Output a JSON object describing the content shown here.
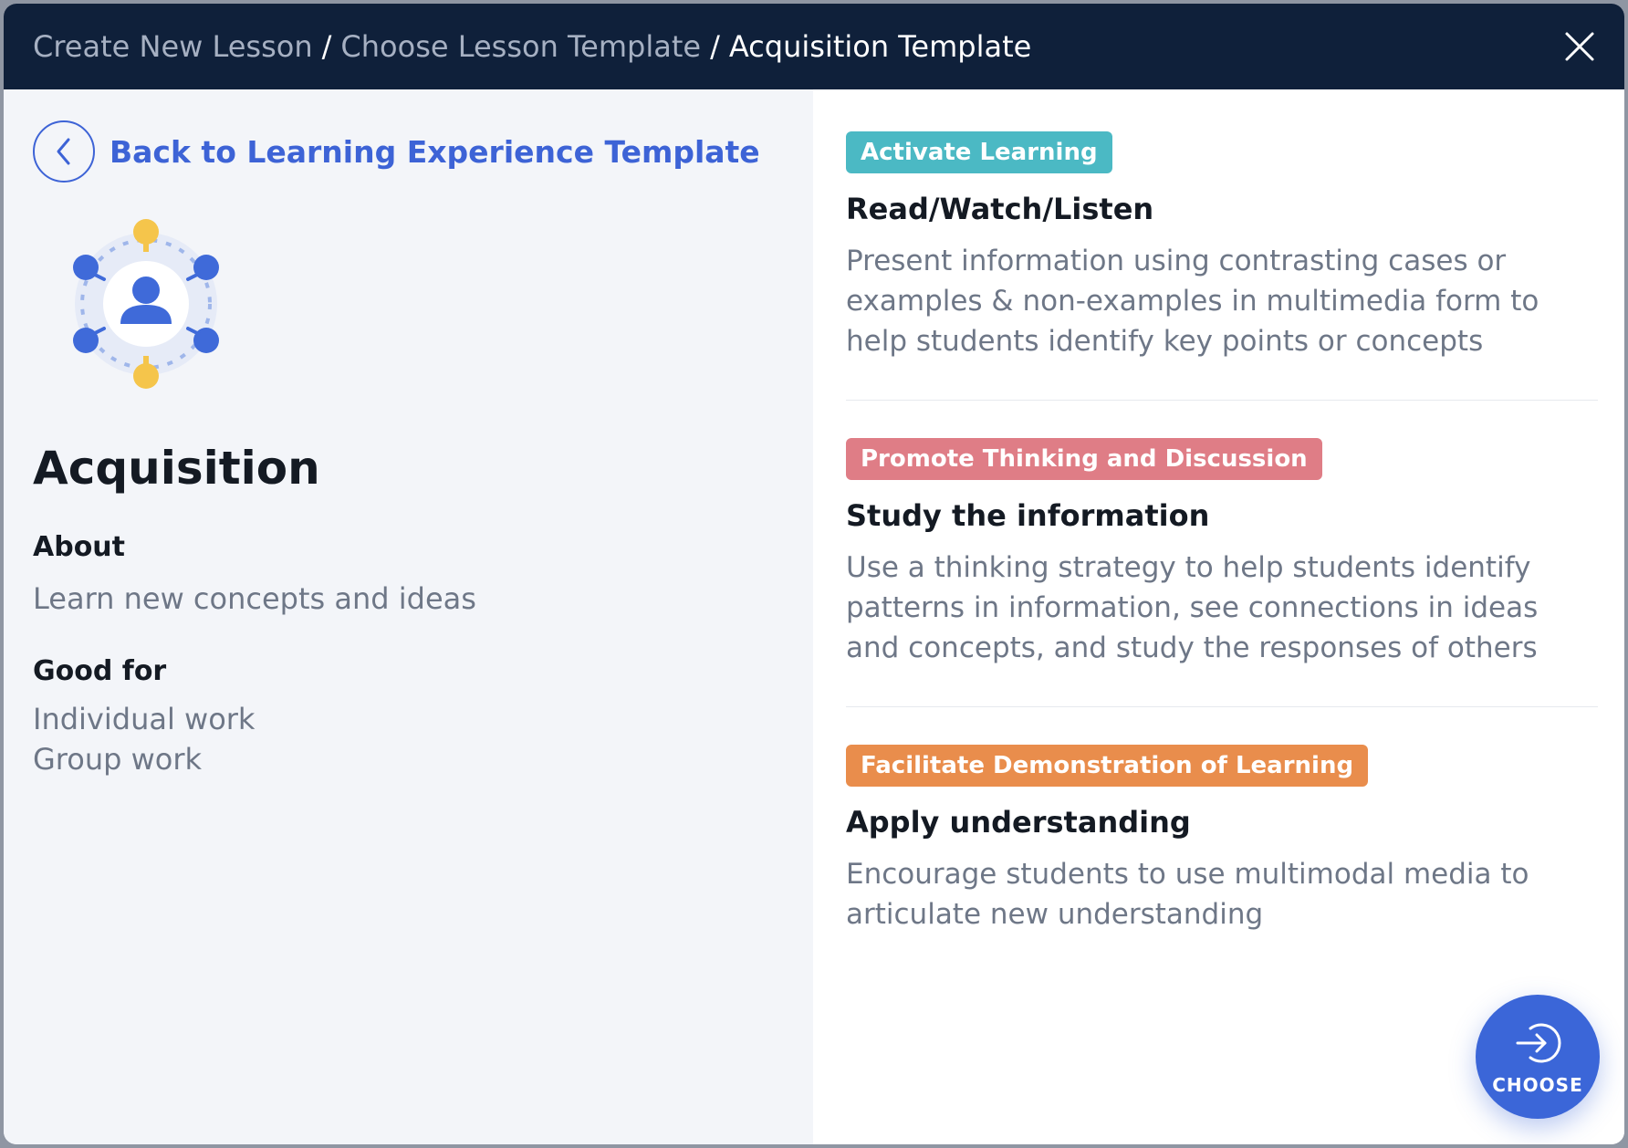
{
  "header": {
    "breadcrumbs": [
      "Create New Lesson",
      "Choose Lesson Template"
    ],
    "current": "Acquisition Template",
    "separator": "/",
    "close_icon": "close-icon"
  },
  "left": {
    "back_label": "Back to Learning Experience Template",
    "back_icon": "chevron-left-icon",
    "illustration_icon": "person-network-icon",
    "title": "Acquisition",
    "about_label": "About",
    "about_text": "Learn new concepts and ideas",
    "good_for_label": "Good for",
    "good_for_items": [
      "Individual work",
      "Group work"
    ]
  },
  "cards": [
    {
      "badge": "Activate Learning",
      "badge_color": "#4bb9c4",
      "title": "Read/Watch/Listen",
      "description": "Present information using contrasting cases or examples & non-examples in multimedia form to help students identify key points or concepts"
    },
    {
      "badge": "Promote Thinking and Discussion",
      "badge_color": "#df7d86",
      "title": "Study the information",
      "description": "Use a thinking strategy to help students identify patterns in information, see connections in ideas and concepts, and study the responses of others"
    },
    {
      "badge": "Facilitate Demonstration of Learning",
      "badge_color": "#e98d4c",
      "title": "Apply understanding",
      "description": "Encourage students to use multimodal media to articulate new understanding"
    }
  ],
  "choose": {
    "label": "CHOOSE",
    "icon": "enter-arrow-icon"
  },
  "colors": {
    "header_bg": "#0f203a",
    "accent": "#3d63d6",
    "left_bg": "#f3f5f9"
  }
}
